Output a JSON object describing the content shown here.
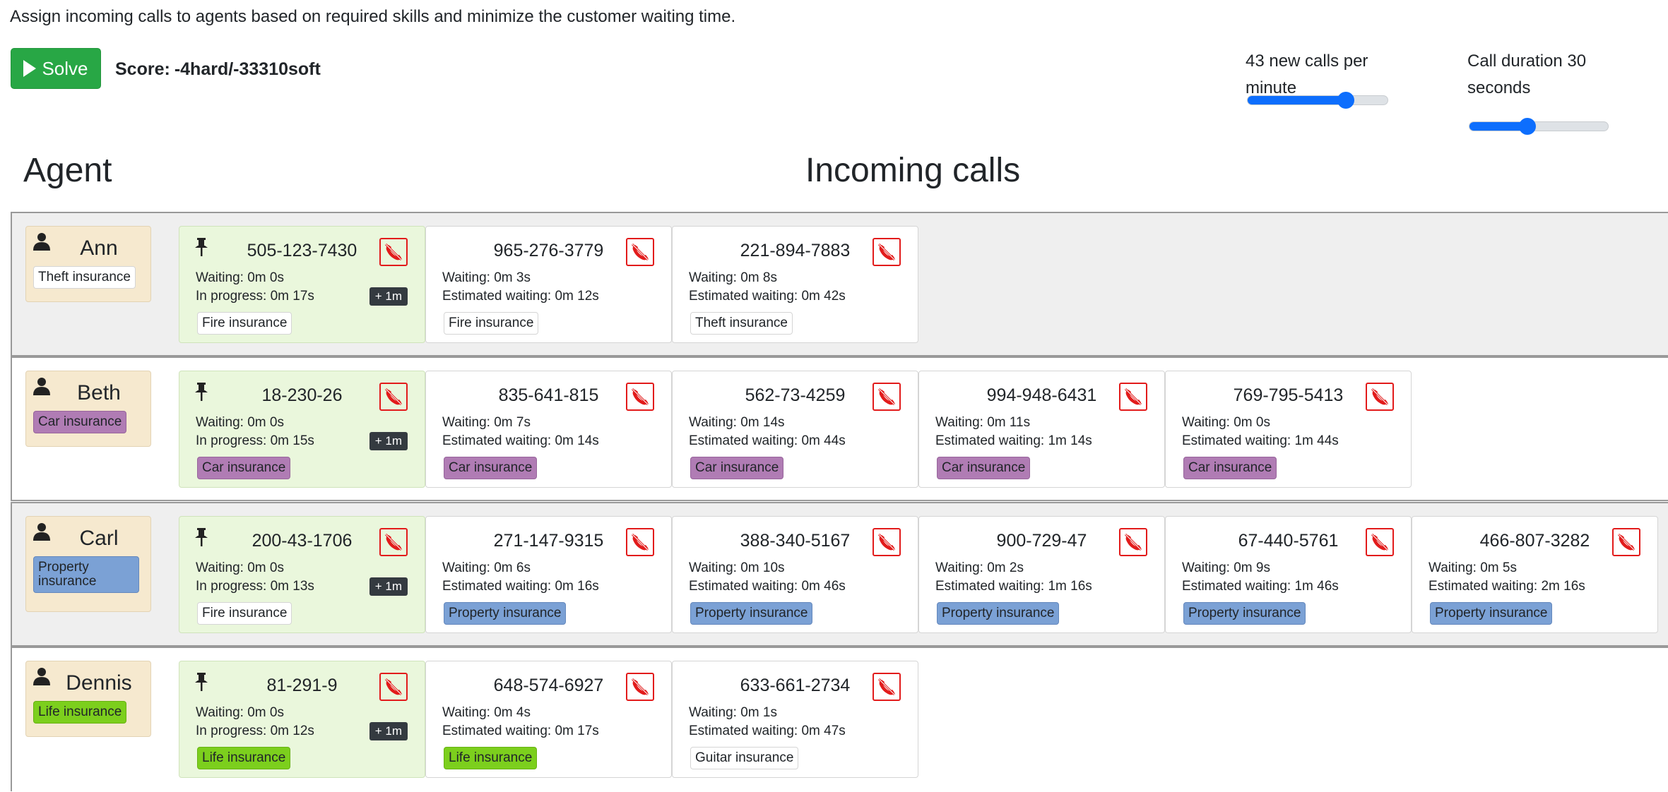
{
  "description": "Assign incoming calls to agents based on required skills and minimize the customer waiting time.",
  "solve_label": "Solve",
  "score": {
    "label": "Score:",
    "value": "-4hard/-33310soft"
  },
  "calls_per_minute": {
    "label": "43 new calls per minute",
    "level": 0.7
  },
  "call_duration": {
    "label": "Call duration 30 seconds",
    "level": 0.42
  },
  "headers": {
    "agent": "Agent",
    "calls": "Incoming calls"
  },
  "colors": {
    "active_call": "#eaf7dc",
    "agent_card": "#f6e9cf",
    "solve": "#28a745",
    "hangup": "#e21b1b"
  },
  "agents": [
    {
      "name": "Ann",
      "skill": {
        "label": "Theft insurance",
        "type": "plain"
      },
      "calls": [
        {
          "phone": "505-123-7430",
          "line1": "Waiting: 0m 0s",
          "line2": "In progress: 0m 17s",
          "plus": "+ 1m",
          "skill": {
            "label": "Fire insurance",
            "type": "plain"
          },
          "active": true
        },
        {
          "phone": "965-276-3779",
          "line1": "Waiting: 0m 3s",
          "line2": "Estimated waiting: 0m 12s",
          "skill": {
            "label": "Fire insurance",
            "type": "plain"
          }
        },
        {
          "phone": "221-894-7883",
          "line1": "Waiting: 0m 8s",
          "line2": "Estimated waiting: 0m 42s",
          "skill": {
            "label": "Theft insurance",
            "type": "plain"
          }
        }
      ]
    },
    {
      "name": "Beth",
      "skill": {
        "label": "Car insurance",
        "type": "car"
      },
      "calls": [
        {
          "phone": "18-230-26",
          "line1": "Waiting: 0m 0s",
          "line2": "In progress: 0m 15s",
          "plus": "+ 1m",
          "skill": {
            "label": "Car insurance",
            "type": "car"
          },
          "active": true
        },
        {
          "phone": "835-641-815",
          "line1": "Waiting: 0m 7s",
          "line2": "Estimated waiting: 0m 14s",
          "skill": {
            "label": "Car insurance",
            "type": "car"
          }
        },
        {
          "phone": "562-73-4259",
          "line1": "Waiting: 0m 14s",
          "line2": "Estimated waiting: 0m 44s",
          "skill": {
            "label": "Car insurance",
            "type": "car"
          }
        },
        {
          "phone": "994-948-6431",
          "line1": "Waiting: 0m 11s",
          "line2": "Estimated waiting: 1m 14s",
          "skill": {
            "label": "Car insurance",
            "type": "car"
          }
        },
        {
          "phone": "769-795-5413",
          "line1": "Waiting: 0m 0s",
          "line2": "Estimated waiting: 1m 44s",
          "skill": {
            "label": "Car insurance",
            "type": "car"
          }
        }
      ]
    },
    {
      "name": "Carl",
      "skill": {
        "label": "Property insurance",
        "type": "property"
      },
      "calls": [
        {
          "phone": "200-43-1706",
          "line1": "Waiting: 0m 0s",
          "line2": "In progress: 0m 13s",
          "plus": "+ 1m",
          "skill": {
            "label": "Fire insurance",
            "type": "plain"
          },
          "active": true
        },
        {
          "phone": "271-147-9315",
          "line1": "Waiting: 0m 6s",
          "line2": "Estimated waiting: 0m 16s",
          "skill": {
            "label": "Property insurance",
            "type": "property"
          }
        },
        {
          "phone": "388-340-5167",
          "line1": "Waiting: 0m 10s",
          "line2": "Estimated waiting: 0m 46s",
          "skill": {
            "label": "Property insurance",
            "type": "property"
          }
        },
        {
          "phone": "900-729-47",
          "line1": "Waiting: 0m 2s",
          "line2": "Estimated waiting: 1m 16s",
          "skill": {
            "label": "Property insurance",
            "type": "property"
          }
        },
        {
          "phone": "67-440-5761",
          "line1": "Waiting: 0m 9s",
          "line2": "Estimated waiting: 1m 46s",
          "skill": {
            "label": "Property insurance",
            "type": "property"
          }
        },
        {
          "phone": "466-807-3282",
          "line1": "Waiting: 0m 5s",
          "line2": "Estimated waiting: 2m 16s",
          "skill": {
            "label": "Property insurance",
            "type": "property"
          }
        }
      ]
    },
    {
      "name": "Dennis",
      "skill": {
        "label": "Life insurance",
        "type": "life"
      },
      "calls": [
        {
          "phone": "81-291-9",
          "line1": "Waiting: 0m 0s",
          "line2": "In progress: 0m 12s",
          "plus": "+ 1m",
          "skill": {
            "label": "Life insurance",
            "type": "life"
          },
          "active": true
        },
        {
          "phone": "648-574-6927",
          "line1": "Waiting: 0m 4s",
          "line2": "Estimated waiting: 0m 17s",
          "skill": {
            "label": "Life insurance",
            "type": "life"
          }
        },
        {
          "phone": "633-661-2734",
          "line1": "Waiting: 0m 1s",
          "line2": "Estimated waiting: 0m 47s",
          "skill": {
            "label": "Guitar insurance",
            "type": "plain"
          }
        }
      ]
    }
  ]
}
